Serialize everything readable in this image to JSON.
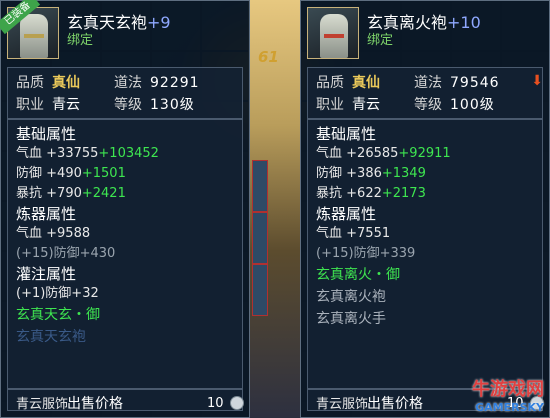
{
  "center_number": "61",
  "left_panel": {
    "ribbon": "已装备",
    "name": "玄真天玄袍",
    "enhance": "+9",
    "bound": "绑定",
    "stats": {
      "quality_label": "品质",
      "quality_value": "真仙",
      "dao_label": "道法",
      "dao_value": "92291",
      "job_label": "职业",
      "job_value": "青云",
      "level_label": "等级",
      "level_value": "130级"
    },
    "base_title": "基础属性",
    "base_attrs": [
      {
        "name": "气血",
        "base": "+33755",
        "bonus": "+103452"
      },
      {
        "name": "防御",
        "base": "+490",
        "bonus": "+1501"
      },
      {
        "name": "暴抗",
        "base": "+790",
        "bonus": "+2421"
      }
    ],
    "refine_title": "炼器属性",
    "refine_attr": "气血 +9588",
    "refine_dim": "(+15)防御+430",
    "infuse_title": "灌注属性",
    "infuse_attr": "(+1)防御+32",
    "set_active": "玄真天玄・御",
    "set_cut": "玄真天玄袍",
    "type": "青云服饰",
    "price_label": "出售价格",
    "price_value": "10"
  },
  "right_panel": {
    "name": "玄真离火袍",
    "enhance": "+10",
    "bound": "绑定",
    "stats": {
      "quality_label": "品质",
      "quality_value": "真仙",
      "dao_label": "道法",
      "dao_value": "79546",
      "job_label": "职业",
      "job_value": "青云",
      "level_label": "等级",
      "level_value": "100级"
    },
    "base_title": "基础属性",
    "base_attrs": [
      {
        "name": "气血",
        "base": "+26585",
        "bonus": "+92911"
      },
      {
        "name": "防御",
        "base": "+386",
        "bonus": "+1349"
      },
      {
        "name": "暴抗",
        "base": "+622",
        "bonus": "+2173"
      }
    ],
    "refine_title": "炼器属性",
    "refine_attr": "气血 +7551",
    "refine_dim": "(+15)防御+339",
    "set_active": "玄真离火・御",
    "set_items": [
      "玄真离火袍",
      "玄真离火手"
    ],
    "type": "青云服饰",
    "price_label": "出售价格",
    "price_value": "10"
  },
  "watermark": "牛游戏网",
  "watermark_sub": "GAMERSKY"
}
